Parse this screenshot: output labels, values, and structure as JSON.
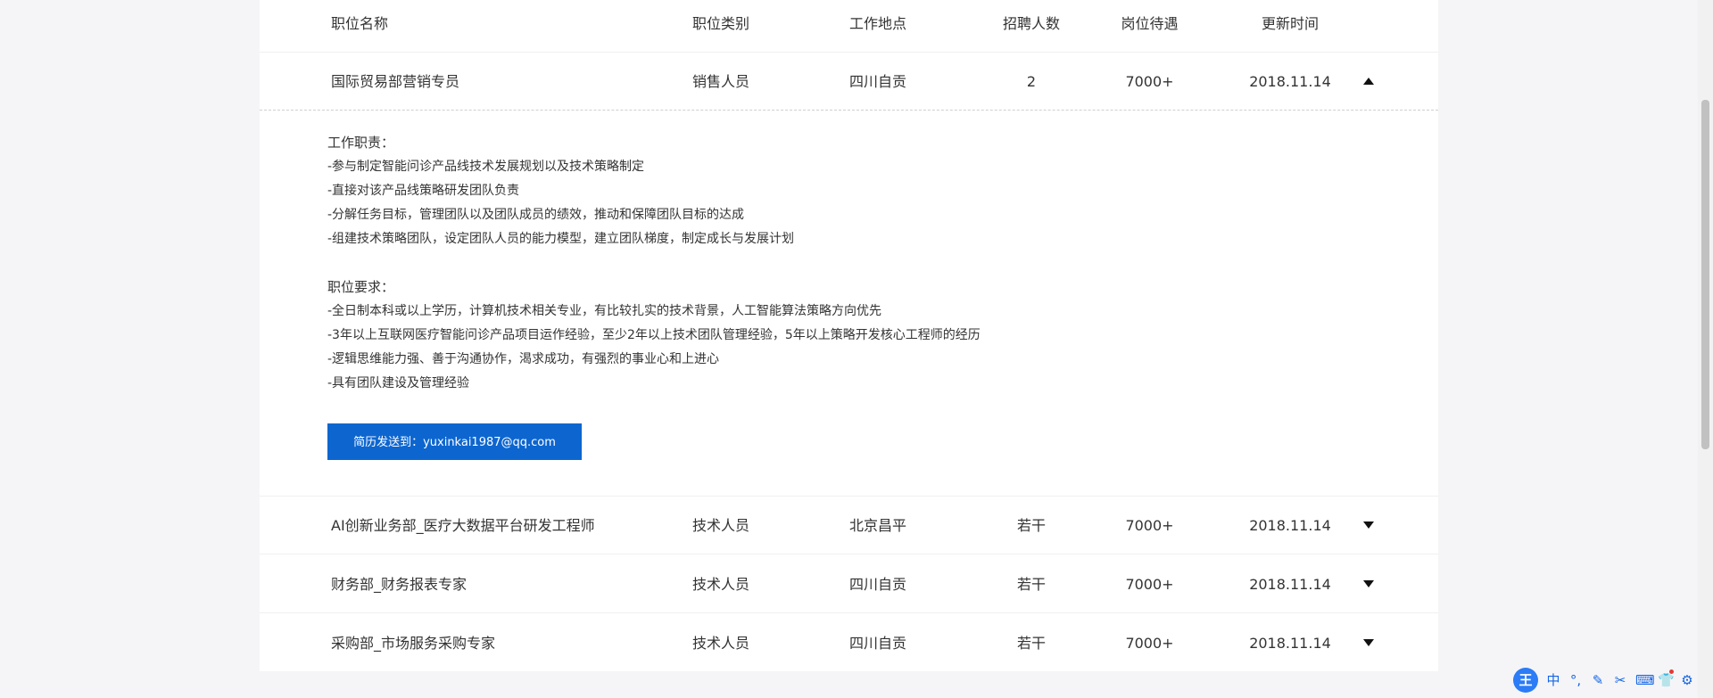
{
  "table": {
    "headers": {
      "name": "职位名称",
      "category": "职位类别",
      "location": "工作地点",
      "count": "招聘人数",
      "salary": "岗位待遇",
      "updated": "更新时间"
    },
    "rows": [
      {
        "name": "国际贸易部营销专员",
        "category": "销售人员",
        "location": "四川自贡",
        "count": "2",
        "salary": "7000+",
        "updated": "2018.11.14",
        "expanded": true,
        "toggle_icon": "caret-up-icon"
      },
      {
        "name": "AI创新业务部_医疗大数据平台研发工程师",
        "category": "技术人员",
        "location": "北京昌平",
        "count": "若干",
        "salary": "7000+",
        "updated": "2018.11.14",
        "expanded": false,
        "toggle_icon": "caret-down-icon"
      },
      {
        "name": "财务部_财务报表专家",
        "category": "技术人员",
        "location": "四川自贡",
        "count": "若干",
        "salary": "7000+",
        "updated": "2018.11.14",
        "expanded": false,
        "toggle_icon": "caret-down-icon"
      },
      {
        "name": "采购部_市场服务采购专家",
        "category": "技术人员",
        "location": "四川自贡",
        "count": "若干",
        "salary": "7000+",
        "updated": "2018.11.14",
        "expanded": false,
        "toggle_icon": "caret-down-icon"
      }
    ]
  },
  "details": {
    "duties_title": "工作职责：",
    "duties": [
      "-参与制定智能问诊产品线技术发展规划以及技术策略制定",
      "-直接对该产品线策略研发团队负责",
      "-分解任务目标，管理团队以及团队成员的绩效，推动和保障团队目标的达成",
      "-组建技术策略团队，设定团队人员的能力模型，建立团队梯度，制定成长与发展计划"
    ],
    "requirements_title": "职位要求：",
    "requirements": [
      "-全日制本科或以上学历，计算机技术相关专业，有比较扎实的技术背景，人工智能算法策略方向优先",
      "-3年以上互联网医疗智能问诊产品项目运作经验，至少2年以上技术团队管理经验，5年以上策略开发核心工程师的经历",
      "-逻辑思维能力强、善于沟通协作，渴求成功，有强烈的事业心和上进心",
      "-具有团队建设及管理经验"
    ],
    "apply_button": "简历发送到：yuxinkai1987@qq.com"
  },
  "ime_toolbar": {
    "logo": "王",
    "mode": "中",
    "items": [
      "°,",
      "✎",
      "✂",
      "⌨",
      "👕",
      "⚙"
    ],
    "icons": [
      "punctuation-icon",
      "pen-icon",
      "scissors-icon",
      "keyboard-icon",
      "skin-icon",
      "settings-icon"
    ]
  },
  "colors": {
    "accent": "#0d66d0",
    "ime_blue": "#1565e6",
    "page_bg": "#f5f5f7"
  }
}
